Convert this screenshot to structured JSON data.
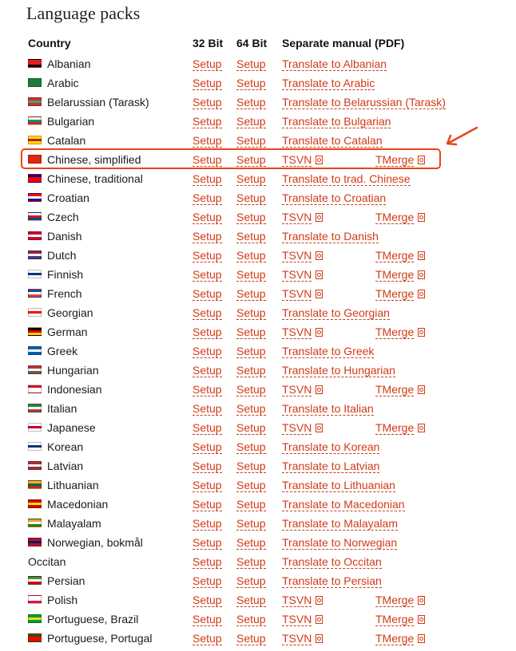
{
  "title": "Language packs",
  "headers": {
    "country": "Country",
    "bit32": "32 Bit",
    "bit64": "64 Bit",
    "manual": "Separate manual (PDF)"
  },
  "rows": [
    {
      "country": "Albanian",
      "flag": [
        "#e41e20",
        "#e41e20",
        "#000000"
      ],
      "s32": "Setup",
      "s64": "Setup",
      "manual": "Translate to Albanian"
    },
    {
      "country": "Arabic",
      "flag": [
        "#1e7a3c",
        "#1e7a3c",
        "#1e7a3c"
      ],
      "s32": "Setup",
      "s64": "Setup",
      "manual": "Translate to Arabic"
    },
    {
      "country": "Belarussian (Tarask)",
      "flag": [
        "#c8313e",
        "#4aa657",
        "#c8313e"
      ],
      "s32": "Setup",
      "s64": "Setup",
      "manual": "Translate to Belarussian (Tarask)"
    },
    {
      "country": "Bulgarian",
      "flag": [
        "#ffffff",
        "#00966e",
        "#d62612"
      ],
      "s32": "Setup",
      "s64": "Setup",
      "manual": "Translate to Bulgarian"
    },
    {
      "country": "Catalan",
      "flag": [
        "#fcdd09",
        "#da121a",
        "#fcdd09"
      ],
      "s32": "Setup",
      "s64": "Setup",
      "manual": "Translate to Catalan"
    },
    {
      "country": "Chinese, simplified",
      "flag": [
        "#de2910",
        "#de2910",
        "#de2910"
      ],
      "s32": "Setup",
      "s64": "Setup",
      "tsvn": "TSVN",
      "tmerge": "TMerge"
    },
    {
      "country": "Chinese, traditional",
      "flag": [
        "#000095",
        "#fe0000",
        "#fe0000"
      ],
      "s32": "Setup",
      "s64": "Setup",
      "manual": "Translate to trad. Chinese"
    },
    {
      "country": "Croatian",
      "flag": [
        "#ff0000",
        "#ffffff",
        "#171796"
      ],
      "s32": "Setup",
      "s64": "Setup",
      "manual": "Translate to Croatian"
    },
    {
      "country": "Czech",
      "flag": [
        "#ffffff",
        "#d7141a",
        "#11457e"
      ],
      "s32": "Setup",
      "s64": "Setup",
      "tsvn": "TSVN",
      "tmerge": "TMerge"
    },
    {
      "country": "Danish",
      "flag": [
        "#c60c30",
        "#ffffff",
        "#c60c30"
      ],
      "s32": "Setup",
      "s64": "Setup",
      "manual": "Translate to Danish"
    },
    {
      "country": "Dutch",
      "flag": [
        "#ae1c28",
        "#ffffff",
        "#21468b"
      ],
      "s32": "Setup",
      "s64": "Setup",
      "tsvn": "TSVN",
      "tmerge": "TMerge"
    },
    {
      "country": "Finnish",
      "flag": [
        "#ffffff",
        "#003580",
        "#ffffff"
      ],
      "s32": "Setup",
      "s64": "Setup",
      "tsvn": "TSVN",
      "tmerge": "TMerge"
    },
    {
      "country": "French",
      "flag": [
        "#0055a4",
        "#ffffff",
        "#ef4135"
      ],
      "s32": "Setup",
      "s64": "Setup",
      "tsvn": "TSVN",
      "tmerge": "TMerge"
    },
    {
      "country": "Georgian",
      "flag": [
        "#ffffff",
        "#ff0000",
        "#ffffff"
      ],
      "s32": "Setup",
      "s64": "Setup",
      "manual": "Translate to Georgian"
    },
    {
      "country": "German",
      "flag": [
        "#000000",
        "#dd0000",
        "#ffce00"
      ],
      "s32": "Setup",
      "s64": "Setup",
      "tsvn": "TSVN",
      "tmerge": "TMerge"
    },
    {
      "country": "Greek",
      "flag": [
        "#0d5eaf",
        "#ffffff",
        "#0d5eaf"
      ],
      "s32": "Setup",
      "s64": "Setup",
      "manual": "Translate to Greek"
    },
    {
      "country": "Hungarian",
      "flag": [
        "#ce2939",
        "#ffffff",
        "#477050"
      ],
      "s32": "Setup",
      "s64": "Setup",
      "manual": "Translate to Hungarian"
    },
    {
      "country": "Indonesian",
      "flag": [
        "#ce1126",
        "#ffffff",
        "#ffffff"
      ],
      "s32": "Setup",
      "s64": "Setup",
      "tsvn": "TSVN",
      "tmerge": "TMerge"
    },
    {
      "country": "Italian",
      "flag": [
        "#009246",
        "#ffffff",
        "#ce2b37"
      ],
      "s32": "Setup",
      "s64": "Setup",
      "manual": "Translate to Italian"
    },
    {
      "country": "Japanese",
      "flag": [
        "#ffffff",
        "#bc002d",
        "#ffffff"
      ],
      "s32": "Setup",
      "s64": "Setup",
      "tsvn": "TSVN",
      "tmerge": "TMerge"
    },
    {
      "country": "Korean",
      "flag": [
        "#ffffff",
        "#003478",
        "#ffffff"
      ],
      "s32": "Setup",
      "s64": "Setup",
      "manual": "Translate to Korean"
    },
    {
      "country": "Latvian",
      "flag": [
        "#9e3039",
        "#ffffff",
        "#9e3039"
      ],
      "s32": "Setup",
      "s64": "Setup",
      "manual": "Translate to Latvian"
    },
    {
      "country": "Lithuanian",
      "flag": [
        "#fdb913",
        "#006a44",
        "#c1272d"
      ],
      "s32": "Setup",
      "s64": "Setup",
      "manual": "Translate to Lithuanian"
    },
    {
      "country": "Macedonian",
      "flag": [
        "#d20000",
        "#ffe600",
        "#d20000"
      ],
      "s32": "Setup",
      "s64": "Setup",
      "manual": "Translate to Macedonian"
    },
    {
      "country": "Malayalam",
      "flag": [
        "#ff9933",
        "#ffffff",
        "#138808"
      ],
      "s32": "Setup",
      "s64": "Setup",
      "manual": "Translate to Malayalam"
    },
    {
      "country": "Norwegian, bokmål",
      "flag": [
        "#ba0c2f",
        "#00205b",
        "#ba0c2f"
      ],
      "s32": "Setup",
      "s64": "Setup",
      "manual": "Translate to Norwegian"
    },
    {
      "country": "Occitan",
      "flag": null,
      "s32": "Setup",
      "s64": "Setup",
      "manual": "Translate to Occitan"
    },
    {
      "country": "Persian",
      "flag": [
        "#239f40",
        "#ffffff",
        "#da0000"
      ],
      "s32": "Setup",
      "s64": "Setup",
      "manual": "Translate to Persian"
    },
    {
      "country": "Polish",
      "flag": [
        "#ffffff",
        "#ffffff",
        "#dc143c"
      ],
      "s32": "Setup",
      "s64": "Setup",
      "tsvn": "TSVN",
      "tmerge": "TMerge"
    },
    {
      "country": "Portuguese, Brazil",
      "flag": [
        "#009c3b",
        "#ffdf00",
        "#009c3b"
      ],
      "s32": "Setup",
      "s64": "Setup",
      "tsvn": "TSVN",
      "tmerge": "TMerge"
    },
    {
      "country": "Portuguese, Portugal",
      "flag": [
        "#006600",
        "#ff0000",
        "#ff0000"
      ],
      "s32": "Setup",
      "s64": "Setup",
      "tsvn": "TSVN",
      "tmerge": "TMerge"
    }
  ],
  "highlight_row": "Chinese, simplified",
  "colors": {
    "link": "#d03a17",
    "highlight": "#e8441c"
  }
}
